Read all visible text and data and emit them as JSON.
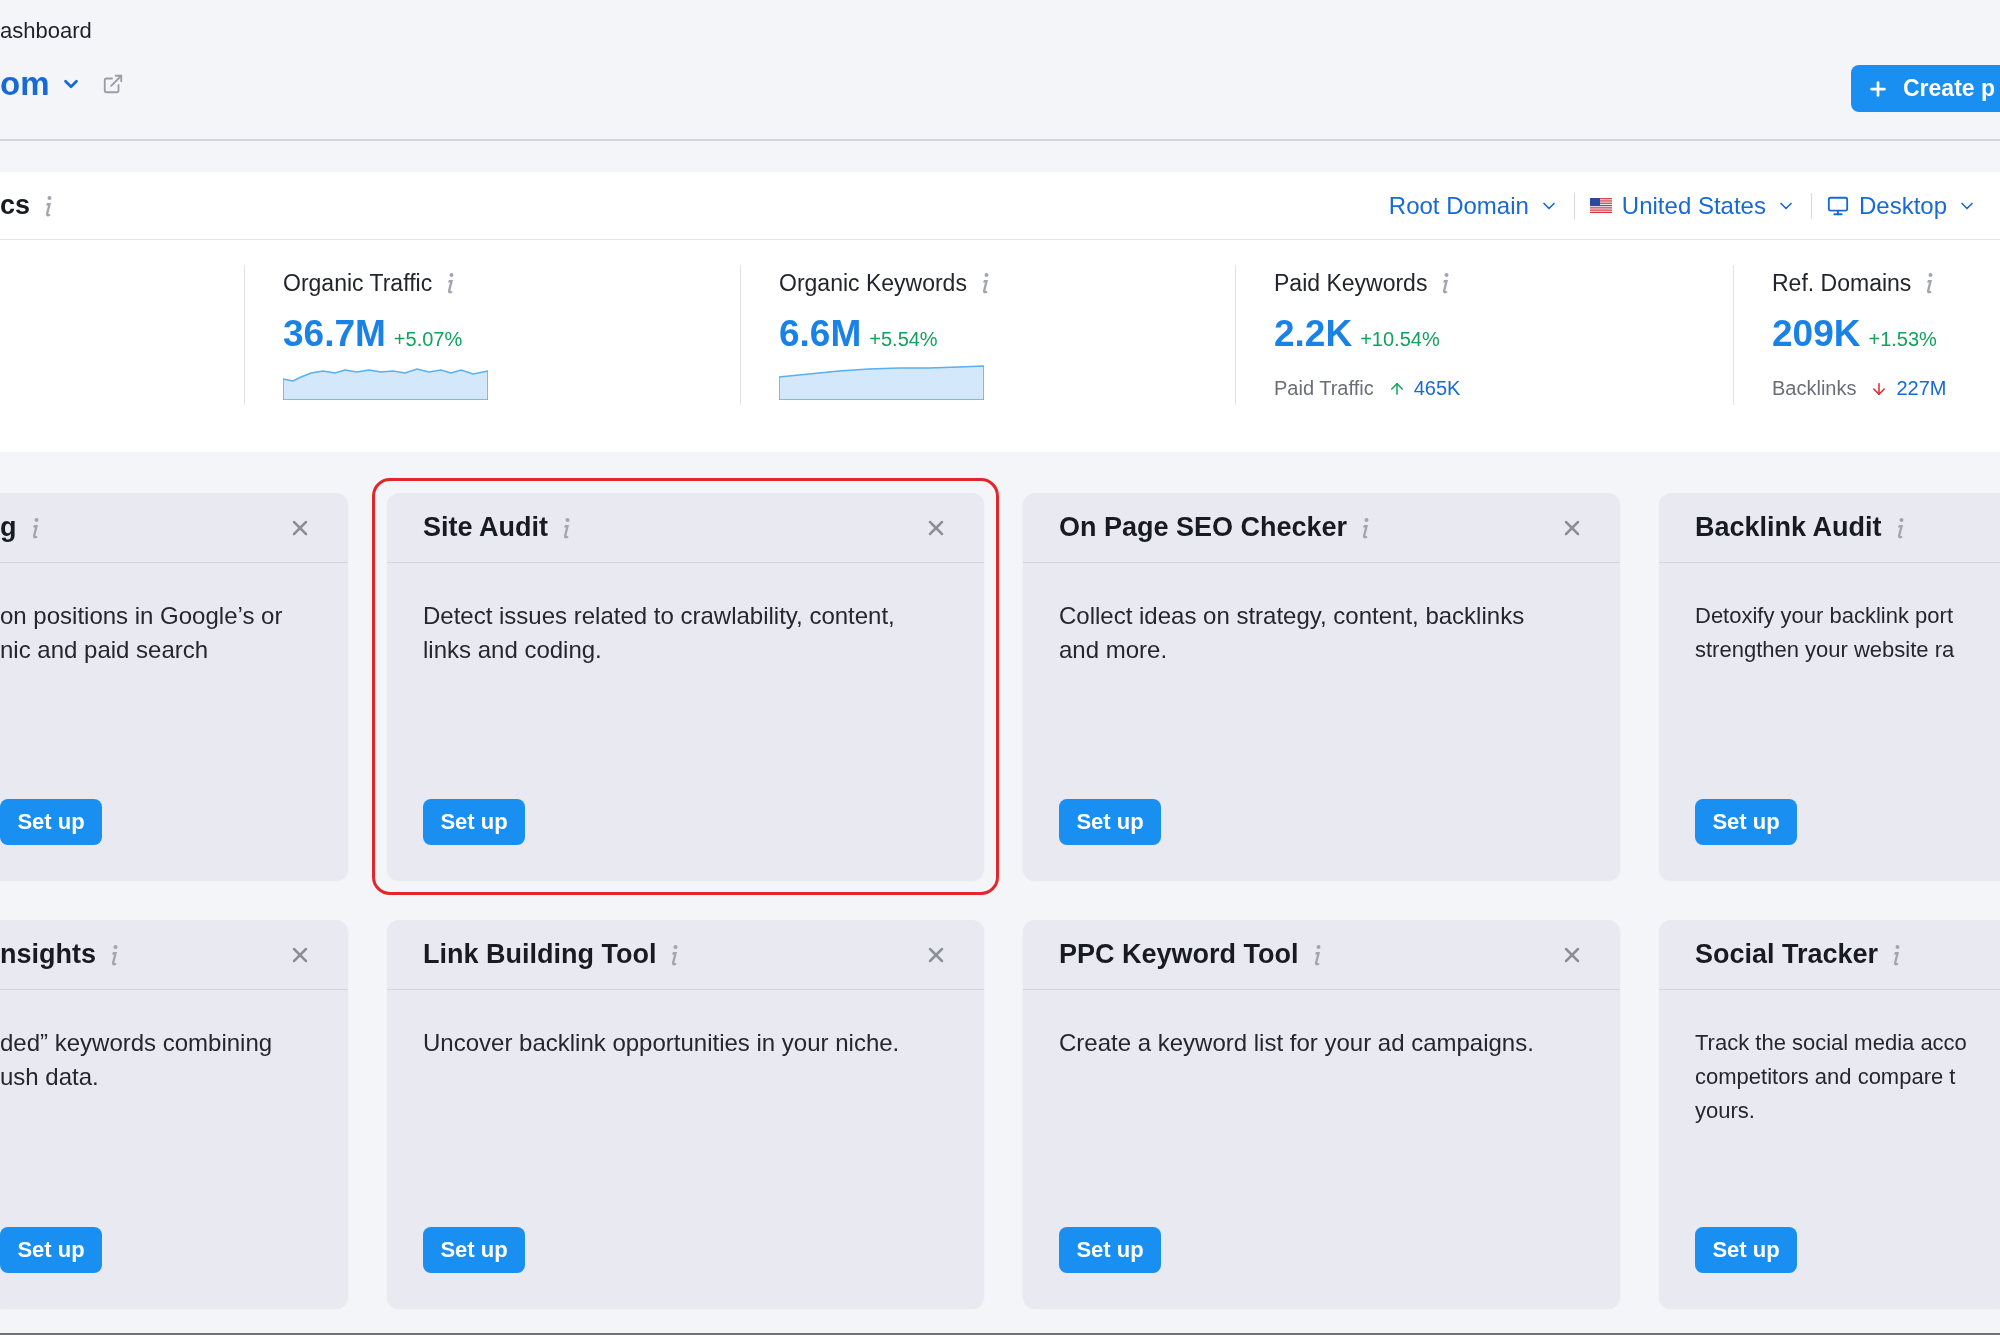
{
  "breadcrumb": "ashboard",
  "project": {
    "name": "om"
  },
  "create_button": "Create p",
  "overview": {
    "title": "cs",
    "filters": [
      {
        "kind": "plain",
        "label": "Root Domain"
      },
      {
        "kind": "flag",
        "label": "United States"
      },
      {
        "kind": "device",
        "label": "Desktop"
      }
    ],
    "metrics": [
      {
        "kind": "sparkline",
        "label": "Organic Traffic",
        "value": "36.7M",
        "change": "+5.07%"
      },
      {
        "kind": "sparkline",
        "label": "Organic Keywords",
        "value": "6.6M",
        "change": "+5.54%"
      },
      {
        "kind": "sub",
        "label": "Paid Keywords",
        "value": "2.2K",
        "change": "+10.54%",
        "sub_label": "Paid Traffic",
        "sub_value": "465K",
        "trend_up": true
      },
      {
        "kind": "sub",
        "label": "Ref. Domains",
        "value": "209K",
        "change": "+1.53%",
        "sub_label": "Backlinks",
        "sub_value": "227M",
        "trend_up": false
      }
    ]
  },
  "cards": [
    {
      "title": "g",
      "description": [
        "on positions in Google’s or",
        "nic and paid search"
      ],
      "button": "Set up",
      "closable": true,
      "highlighted": false
    },
    {
      "title": "Site Audit",
      "description": [
        "Detect issues related to crawlability, content,",
        "links and coding."
      ],
      "button": "Set up",
      "closable": true,
      "highlighted": true
    },
    {
      "title": "On Page SEO Checker",
      "description": [
        "Collect ideas on strategy, content, backlinks",
        "and more."
      ],
      "button": "Set up",
      "closable": true,
      "highlighted": false
    },
    {
      "title": "Backlink Audit",
      "description": [
        "Detoxify your backlink port",
        "strengthen your website ra"
      ],
      "button": "Set up",
      "closable": false,
      "highlighted": false
    },
    {
      "title": "nsights",
      "description": [
        "ded” keywords combining",
        "ush data."
      ],
      "button": "Set up",
      "closable": true,
      "highlighted": false
    },
    {
      "title": "Link Building Tool",
      "description": [
        "Uncover backlink opportunities in your niche."
      ],
      "button": "Set up",
      "closable": true,
      "highlighted": false
    },
    {
      "title": "PPC Keyword Tool",
      "description": [
        "Create a keyword list for your ad campaigns."
      ],
      "button": "Set up",
      "closable": true,
      "highlighted": false
    },
    {
      "title": "Social Tracker",
      "description": [
        "Track the social media acco",
        "competitors and compare t",
        "yours."
      ],
      "button": "Set up",
      "closable": false,
      "highlighted": false
    }
  ]
}
